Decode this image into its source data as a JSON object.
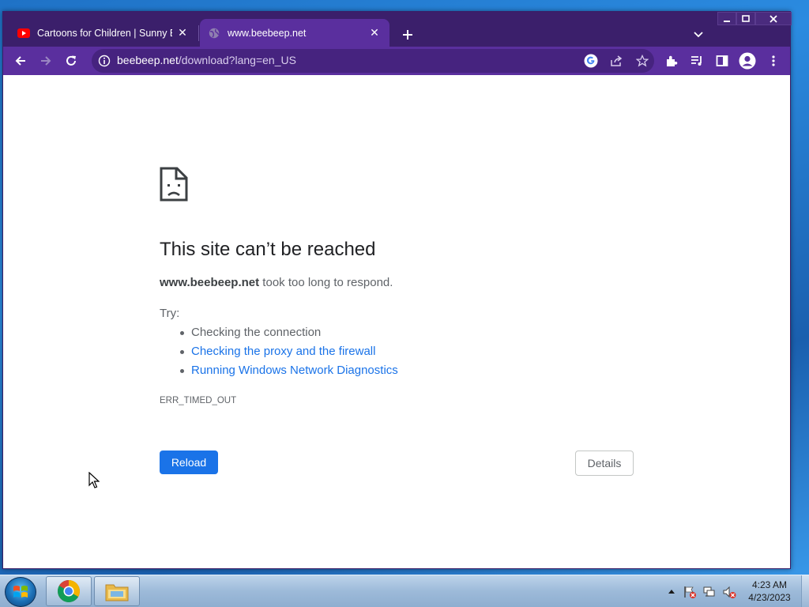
{
  "browser": {
    "tabs": [
      {
        "title": "Cartoons for Children | Sunny Bu",
        "favicon": "youtube-icon",
        "active": false
      },
      {
        "title": "www.beebeep.net",
        "favicon": "globe-icon",
        "active": true
      }
    ],
    "address": {
      "host": "beebeep.net",
      "path": "/download?lang=en_US"
    },
    "accent_colors": {
      "frame": "#3b1f6b",
      "toolbar": "#5a2f9e",
      "link": "#1a73e8"
    }
  },
  "error_page": {
    "title": "This site can’t be reached",
    "host": "www.beebeep.net",
    "summary_suffix": " took too long to respond.",
    "try_label": "Try:",
    "suggestions": [
      {
        "text": "Checking the connection",
        "link": false
      },
      {
        "text": "Checking the proxy and the firewall",
        "link": true
      },
      {
        "text": "Running Windows Network Diagnostics",
        "link": true
      }
    ],
    "error_code": "ERR_TIMED_OUT",
    "reload_label": "Reload",
    "details_label": "Details"
  },
  "taskbar": {
    "pinned": [
      "chrome-icon",
      "file-explorer-icon"
    ],
    "clock_time": "4:23 AM",
    "clock_date": "4/23/2023"
  }
}
